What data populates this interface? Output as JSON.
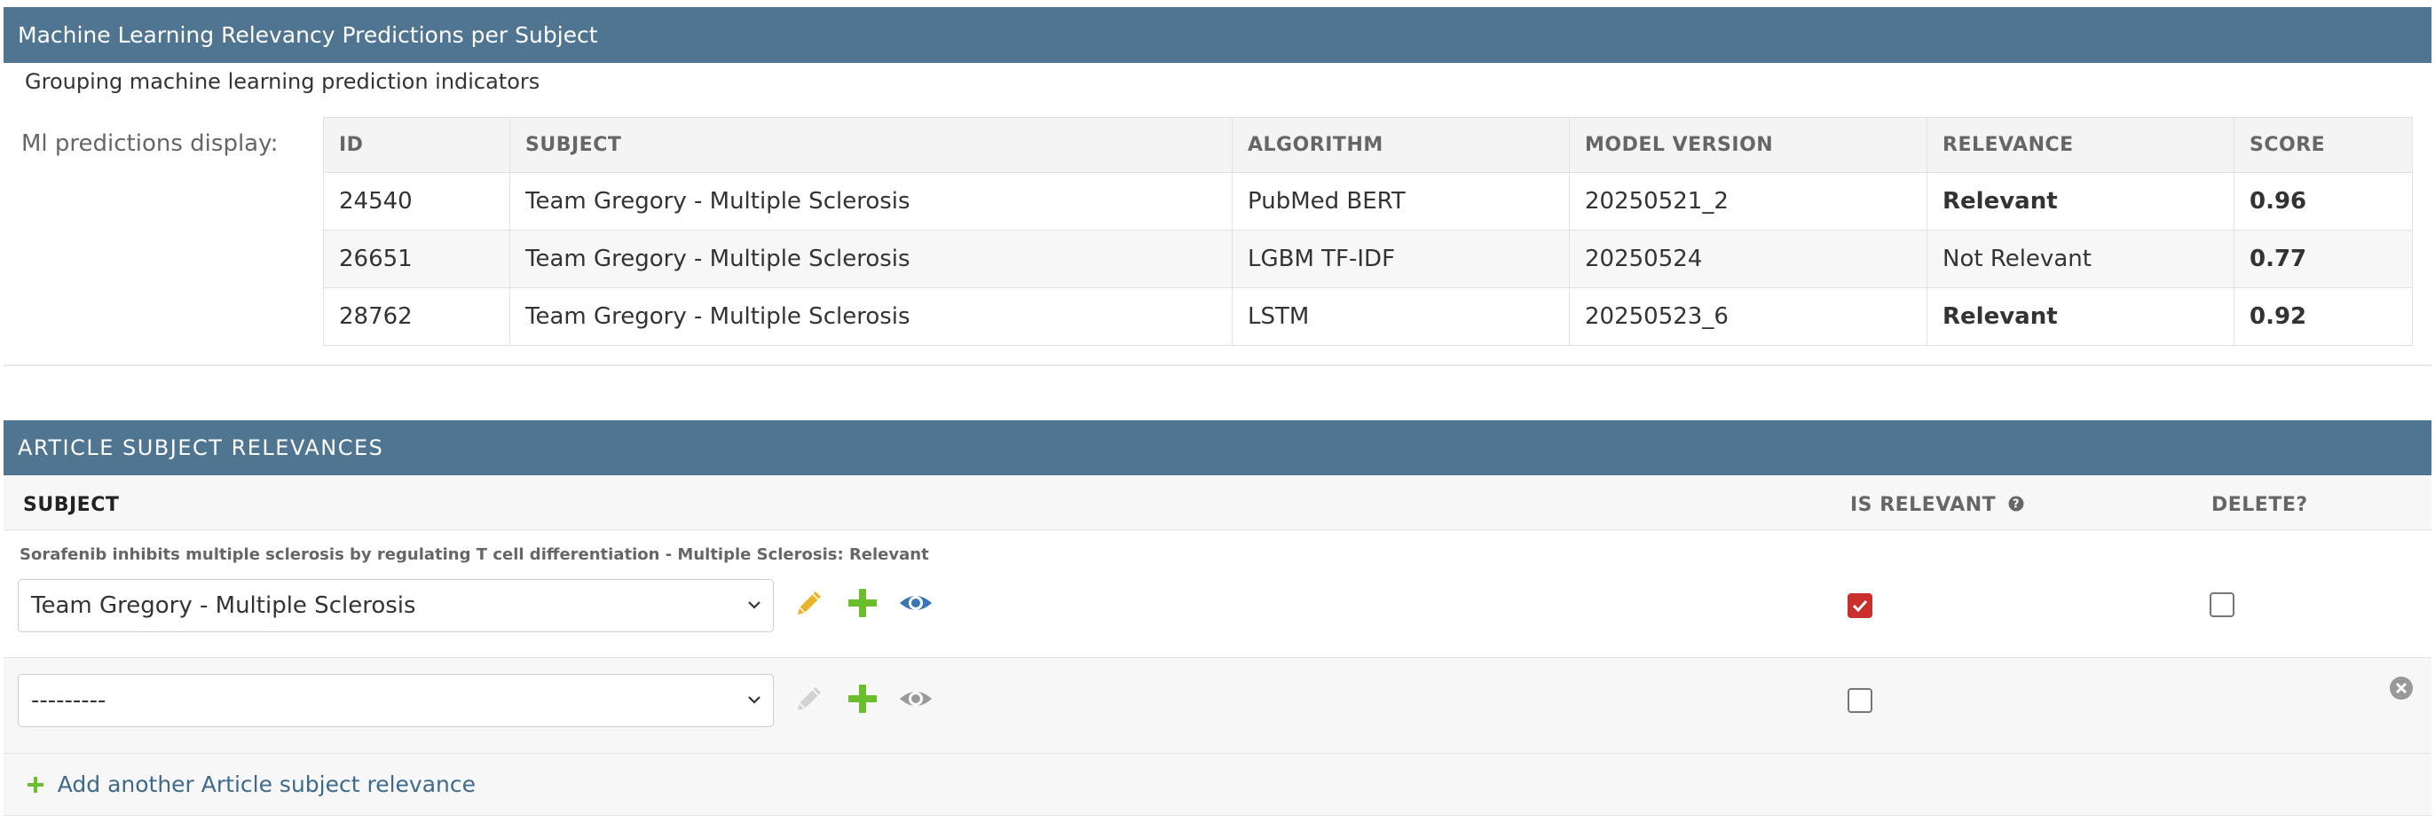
{
  "ml_section": {
    "title": "Machine Learning Relevancy Predictions per Subject",
    "description": "Grouping machine learning prediction indicators",
    "field_label": "Ml predictions display:",
    "columns": [
      "ID",
      "SUBJECT",
      "ALGORITHM",
      "MODEL VERSION",
      "RELEVANCE",
      "SCORE"
    ],
    "rows": [
      {
        "id": "24540",
        "subject": "Team Gregory - Multiple Sclerosis",
        "algorithm": "PubMed BERT",
        "model_version": "20250521_2",
        "relevance": "Relevant",
        "score": "0.96"
      },
      {
        "id": "26651",
        "subject": "Team Gregory - Multiple Sclerosis",
        "algorithm": "LGBM TF-IDF",
        "model_version": "20250524",
        "relevance": "Not Relevant",
        "score": "0.77"
      },
      {
        "id": "28762",
        "subject": "Team Gregory - Multiple Sclerosis",
        "algorithm": "LSTM",
        "model_version": "20250523_6",
        "relevance": "Relevant",
        "score": "0.92"
      }
    ],
    "relevance_colors": {
      "relevant": "#2e7d1e",
      "not_relevant": "#d6261d"
    }
  },
  "inline": {
    "title": "ARTICLE SUBJECT RELEVANCES",
    "columns": {
      "subject": "SUBJECT",
      "is_relevant": "IS RELEVANT",
      "delete": "DELETE?"
    },
    "rows": [
      {
        "original": "Sorafenib inhibits multiple sclerosis by regulating T cell differentiation - Multiple Sclerosis: Relevant",
        "selected": "Team Gregory - Multiple Sclerosis",
        "is_relevant": true,
        "delete": false,
        "icons": [
          "pencil-icon",
          "plus-icon",
          "eye-icon"
        ]
      },
      {
        "original": "",
        "selected": "---------",
        "is_relevant": false,
        "icons": [
          "pencil-icon-disabled",
          "plus-icon",
          "eye-icon-disabled"
        ]
      }
    ],
    "add_link": "Add another Article subject relevance"
  },
  "colors": {
    "header_bg": "#4f7591",
    "add_green": "#6cbd2b",
    "edit_yellow": "#e9b42a",
    "view_blue": "#3a76b3",
    "checkbox_red": "#c9302c"
  }
}
